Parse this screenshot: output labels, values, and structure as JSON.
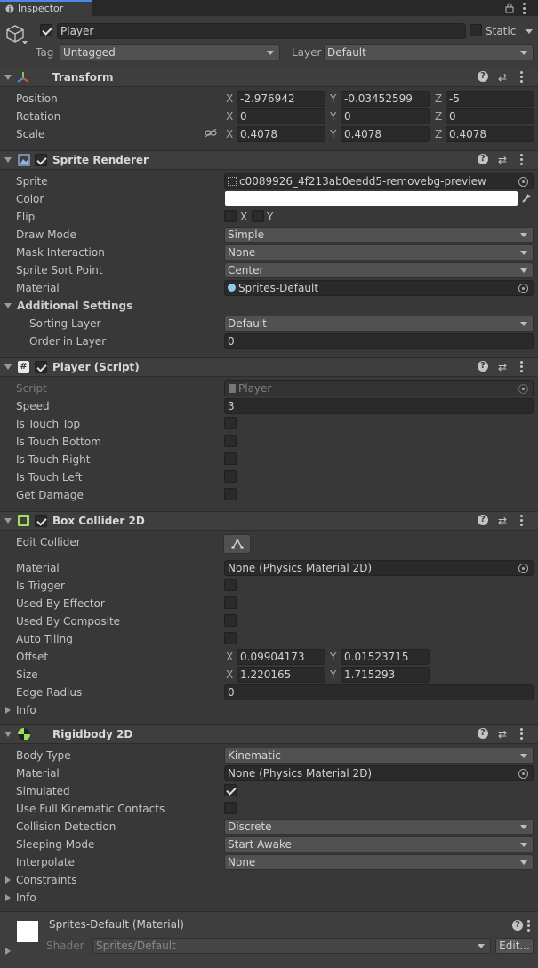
{
  "window": {
    "tab_label": "Inspector"
  },
  "object": {
    "name": "Player",
    "static_label": "Static",
    "tag_label": "Tag",
    "tag_value": "Untagged",
    "layer_label": "Layer",
    "layer_value": "Default"
  },
  "transform": {
    "title": "Transform",
    "rows": [
      {
        "label": "Position",
        "x": "-2.976942",
        "y": "-0.03452599",
        "z": "-5"
      },
      {
        "label": "Rotation",
        "x": "0",
        "y": "0",
        "z": "0"
      },
      {
        "label": "Scale",
        "x": "0.4078",
        "y": "0.4078",
        "z": "0.4078"
      }
    ]
  },
  "axes": {
    "x": "X",
    "y": "Y",
    "z": "Z"
  },
  "sprite_renderer": {
    "title": "Sprite Renderer",
    "sprite_label": "Sprite",
    "sprite_value": "c0089926_4f213ab0eedd5-removebg-preview",
    "color_label": "Color",
    "color_value": "#ffffff",
    "flip_label": "Flip",
    "flip_x": "X",
    "flip_y": "Y",
    "draw_mode_label": "Draw Mode",
    "draw_mode_value": "Simple",
    "mask_label": "Mask Interaction",
    "mask_value": "None",
    "sort_point_label": "Sprite Sort Point",
    "sort_point_value": "Center",
    "material_label": "Material",
    "material_value": "Sprites-Default",
    "additional_label": "Additional Settings",
    "sorting_layer_label": "Sorting Layer",
    "sorting_layer_value": "Default",
    "order_label": "Order in Layer",
    "order_value": "0"
  },
  "player_script": {
    "title": "Player (Script)",
    "script_label": "Script",
    "script_value": "Player",
    "speed_label": "Speed",
    "speed_value": "3",
    "bools": [
      "Is Touch Top",
      "Is Touch Bottom",
      "Is Touch Right",
      "Is Touch Left",
      "Get Damage"
    ]
  },
  "box_collider": {
    "title": "Box Collider 2D",
    "edit_label": "Edit Collider",
    "material_label": "Material",
    "material_value": "None (Physics Material 2D)",
    "bools": [
      "Is Trigger",
      "Used By Effector",
      "Used By Composite",
      "Auto Tiling"
    ],
    "offset_label": "Offset",
    "offset_x": "0.09904173",
    "offset_y": "0.01523715",
    "size_label": "Size",
    "size_x": "1.220165",
    "size_y": "1.715293",
    "edge_label": "Edge Radius",
    "edge_value": "0",
    "info_label": "Info"
  },
  "rigidbody": {
    "title": "Rigidbody 2D",
    "body_type_label": "Body Type",
    "body_type_value": "Kinematic",
    "material_label": "Material",
    "material_value": "None (Physics Material 2D)",
    "simulated_label": "Simulated",
    "full_kinematic_label": "Use Full Kinematic Contacts",
    "collision_label": "Collision Detection",
    "collision_value": "Discrete",
    "sleeping_label": "Sleeping Mode",
    "sleeping_value": "Start Awake",
    "interpolate_label": "Interpolate",
    "interpolate_value": "None",
    "constraints_label": "Constraints",
    "info_label": "Info"
  },
  "material_footer": {
    "title": "Sprites-Default (Material)",
    "shader_label": "Shader",
    "shader_value": "Sprites/Default",
    "edit_label": "Edit..."
  },
  "colors": {
    "accent": "#4a8ae6",
    "panel": "#383838",
    "header": "#3e3e3e",
    "field": "#2a2a2a"
  }
}
